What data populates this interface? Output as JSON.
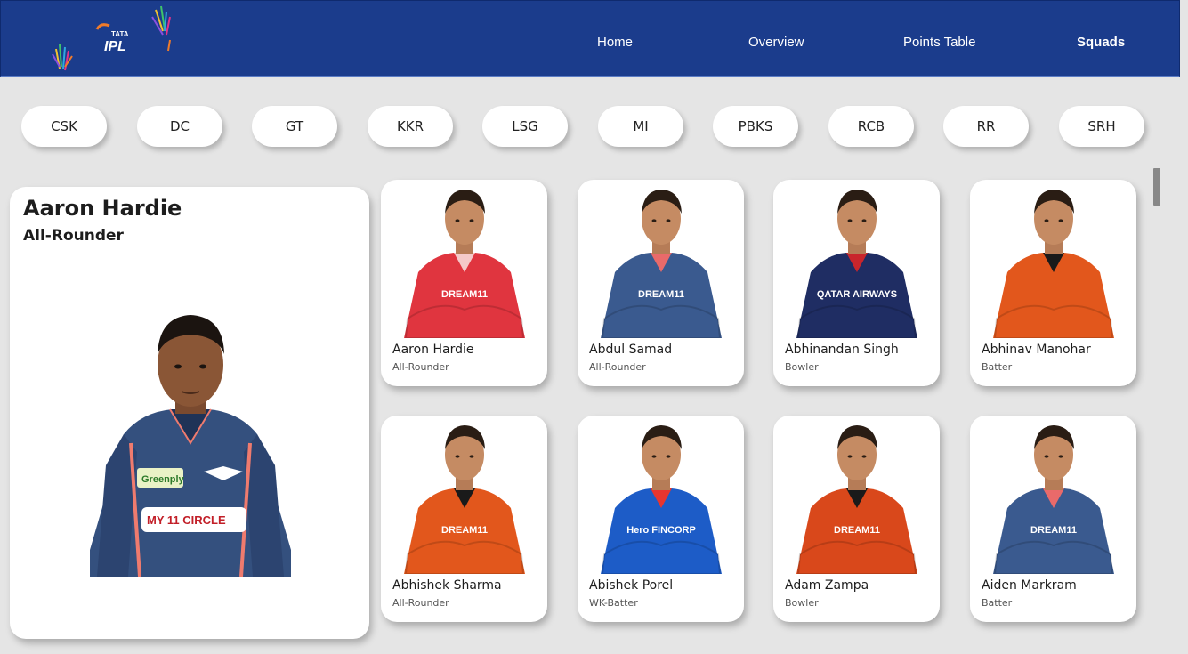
{
  "brand": {
    "logo_text_top": "TATA",
    "logo_text_main": "IPL"
  },
  "nav": [
    {
      "label": "Home",
      "active": false
    },
    {
      "label": "Overview",
      "active": false
    },
    {
      "label": "Points Table",
      "active": false
    },
    {
      "label": "Squads",
      "active": true
    }
  ],
  "teams": [
    "CSK",
    "DC",
    "GT",
    "KKR",
    "LSG",
    "MI",
    "PBKS",
    "RCB",
    "RR",
    "SRH"
  ],
  "featured": {
    "name": "Aaron Hardie",
    "role": "All-Rounder",
    "jersey_sponsor": "MY 11 CIRCLE",
    "jersey_brand": "Greenply"
  },
  "players": [
    {
      "name": "Aaron Hardie",
      "role": "All-Rounder",
      "jersey_color": "#e0353f",
      "trim_color": "#f5c9c9",
      "sponsor": "DREAM11"
    },
    {
      "name": "Abdul Samad",
      "role": "All-Rounder",
      "jersey_color": "#3a5a8f",
      "trim_color": "#e96a6a",
      "sponsor": "DREAM11"
    },
    {
      "name": "Abhinandan Singh",
      "role": "Bowler",
      "jersey_color": "#1f2d63",
      "trim_color": "#c9252c",
      "sponsor": "QATAR AIRWAYS"
    },
    {
      "name": "Abhinav Manohar",
      "role": "Batter",
      "jersey_color": "#e2571c",
      "trim_color": "#1a1a1a",
      "sponsor": ""
    },
    {
      "name": "Abhishek Sharma",
      "role": "All-Rounder",
      "jersey_color": "#e2571c",
      "trim_color": "#1a1a1a",
      "sponsor": "DREAM11"
    },
    {
      "name": "Abishek Porel",
      "role": "WK-Batter",
      "jersey_color": "#1d5cc7",
      "trim_color": "#e8352f",
      "sponsor": "Hero FINCORP"
    },
    {
      "name": "Adam Zampa",
      "role": "Bowler",
      "jersey_color": "#d9481b",
      "trim_color": "#1a1a1a",
      "sponsor": "DREAM11"
    },
    {
      "name": "Aiden Markram",
      "role": "Batter",
      "jersey_color": "#3a5a8f",
      "trim_color": "#e96a6a",
      "sponsor": "DREAM11"
    }
  ]
}
